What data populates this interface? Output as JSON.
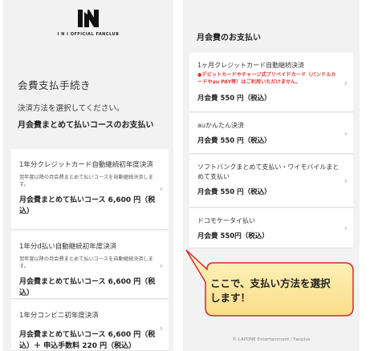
{
  "left": {
    "logo_text": "I N I  OFFICIAL FANCLUB",
    "title": "会費支払手続き",
    "instruction": "決済方法を選択してください。",
    "heading": "月会費まとめて払いコースのお支払い",
    "options": [
      {
        "title": "1年分クレジットカード自動継続初年度決済",
        "note": "翌年度以降の月会費まとめて払いコースを自動継続決済します。",
        "price": "月会費まとめて払いコース 6,600 円（税込）"
      },
      {
        "title": "1年分d払い自動継続初年度決済",
        "note": "翌年度以降の月会費まとめて払いコースを自動継続決済します。",
        "price": "月会費まとめて払いコース 6,600 円（税込）"
      },
      {
        "title": "1年分コンビニ初年度決済",
        "price": "月会費まとめて払いコース 6,600 円（税込）＋ 申込手数料 220 円（税込）"
      }
    ]
  },
  "right": {
    "title": "月会費のお支払い",
    "options": [
      {
        "title": "1ヶ月クレジットカード自動継続決済",
        "warning": "●デビットカードやチャージ式プリペイドカード（バンドルカードやau PAY等）はご利用いただけません。",
        "price": "月会費 550 円（税込）"
      },
      {
        "title": "auかんたん決済",
        "price": "月会費 550 円（税込）"
      },
      {
        "title": "ソフトバンクまとめて支払い・ワイモバイルまとめて支払い",
        "price": "月会費 550 円（税込）"
      },
      {
        "title": "ドコモケータイ払い",
        "price": "月会費 550円（税込）"
      }
    ],
    "footer": "© LAPONE Entertainment / Fanplus"
  },
  "callout": {
    "text": "ここで、支払い方法を選択します！"
  },
  "colors": {
    "panel_bg": "#f2f2f2",
    "card_bg": "#ffffff",
    "warning": "#e03a3a",
    "callout_fill": "#fde9a6",
    "callout_stroke": "#d9262e"
  },
  "icons": {
    "chevron": "chevron-right-icon"
  }
}
